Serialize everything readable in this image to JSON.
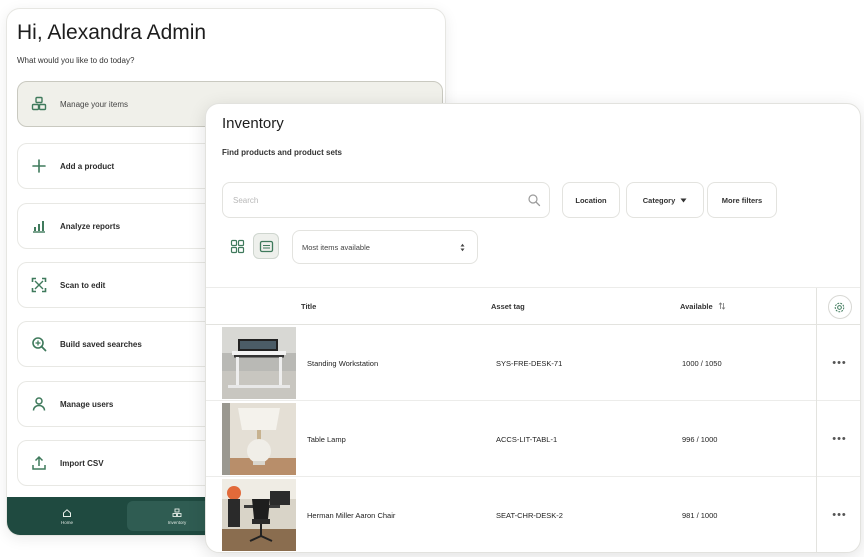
{
  "admin": {
    "greeting": "Hi, Alexandra Admin",
    "subtitle": "What would you like to do today?",
    "menu": [
      {
        "label": "Manage your items",
        "icon": "boxes-icon",
        "active": true
      },
      {
        "label": "Add a product",
        "icon": "plus-icon"
      },
      {
        "label": "Analyze reports",
        "icon": "bar-chart-icon"
      },
      {
        "label": "Scan to edit",
        "icon": "scan-icon"
      },
      {
        "label": "Build saved searches",
        "icon": "search-plus-icon"
      },
      {
        "label": "Manage users",
        "icon": "user-icon"
      },
      {
        "label": "Import CSV",
        "icon": "upload-icon"
      }
    ],
    "nav": [
      {
        "label": "Home",
        "icon": "home-icon"
      },
      {
        "label": "Inventory",
        "icon": "inventory-icon",
        "active": true
      }
    ]
  },
  "inventory": {
    "title": "Inventory",
    "subtitle": "Find products and product sets",
    "search_placeholder": "Search",
    "filters": {
      "location": "Location",
      "category": "Category",
      "more": "More filters"
    },
    "sort_value": "Most items available",
    "columns": {
      "title": "Title",
      "asset_tag": "Asset tag",
      "available": "Available"
    },
    "rows": [
      {
        "title": "Standing Workstation",
        "asset_tag": "SYS-FRE-DESK-71",
        "available": "1000 / 1050",
        "menu": "•••"
      },
      {
        "title": "Table Lamp",
        "asset_tag": "ACCS-LIT-TABL-1",
        "available": "996 / 1000",
        "menu": "•••"
      },
      {
        "title": "Herman Miller Aaron Chair",
        "asset_tag": "SEAT-CHR-DESK-2",
        "available": "981 / 1000",
        "menu": "•••"
      }
    ]
  },
  "colors": {
    "accent": "#1f4a40",
    "icon_green": "#3f7a5c"
  }
}
